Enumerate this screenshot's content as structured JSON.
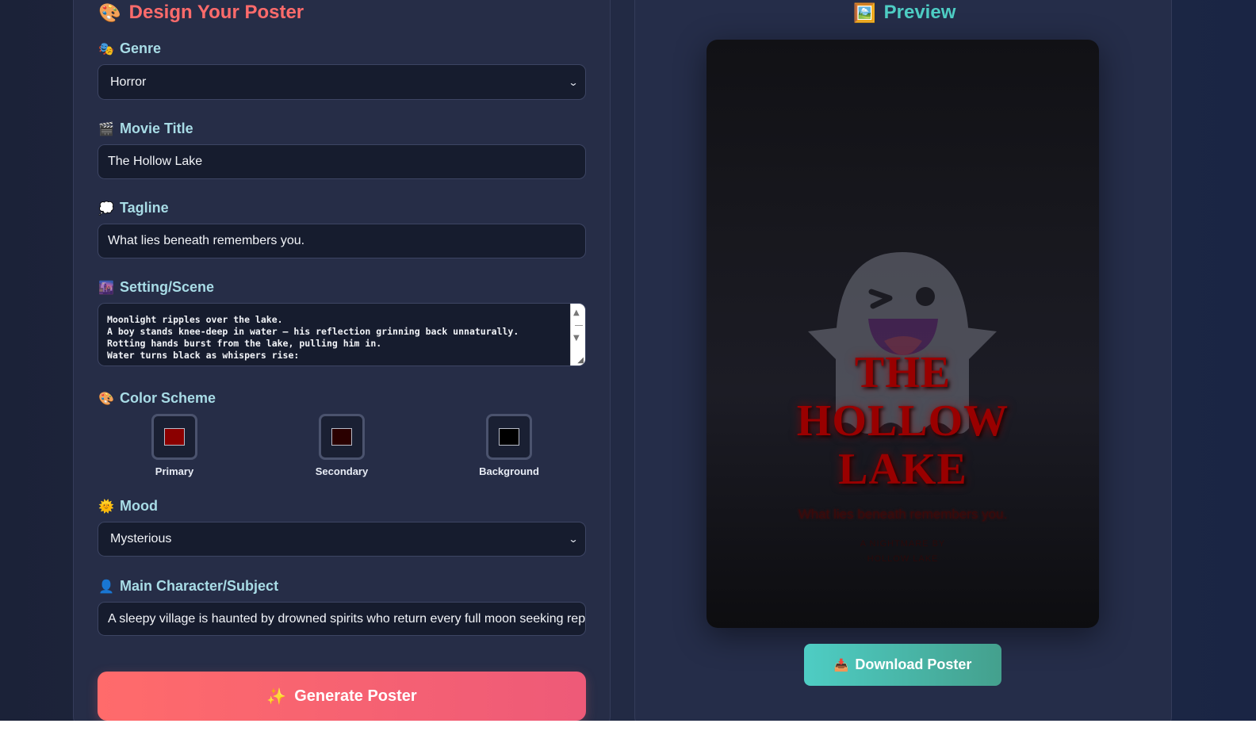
{
  "form": {
    "heading": "Design Your Poster",
    "heading_icon": "palette-icon",
    "genre": {
      "label": "Genre",
      "icon": "theater-masks-icon",
      "value": "Horror"
    },
    "movie_title": {
      "label": "Movie Title",
      "icon": "clapper-board-icon",
      "value": "The Hollow Lake"
    },
    "tagline": {
      "label": "Tagline",
      "icon": "speech-bubble-icon",
      "value": "What lies beneath remembers you."
    },
    "setting": {
      "label": "Setting/Scene",
      "icon": "city-night-icon",
      "value": "Moonlight ripples over the lake.\nA boy stands knee-deep in water — his reflection grinning back unnaturally.\nRotting hands burst from the lake, pulling him in.\nWater turns black as whispers rise:"
    },
    "color_scheme": {
      "label": "Color Scheme",
      "icon": "palette-icon",
      "swatches": [
        {
          "label": "Primary",
          "color": "#8b0000"
        },
        {
          "label": "Secondary",
          "color": "#2a0000"
        },
        {
          "label": "Background",
          "color": "#000000"
        }
      ]
    },
    "mood": {
      "label": "Mood",
      "icon": "sun-icon",
      "value": "Mysterious"
    },
    "main_character": {
      "label": "Main Character/Subject",
      "icon": "person-silhouette-icon",
      "value": "A sleepy village is haunted by drowned spirits who return every full moon seeking rep"
    },
    "generate_button": "Generate Poster",
    "generate_icon": "sparkles-icon"
  },
  "preview": {
    "heading": "Preview",
    "heading_icon": "framed-picture-icon",
    "poster": {
      "title_lines": [
        "THE",
        "HOLLOW",
        "LAKE"
      ],
      "tagline": "What lies beneath remembers you.",
      "credit_lines": [
        "A NIGHTMARE BY",
        "HOLLOW LAKE"
      ],
      "image_icon": "winking-ghost-icon",
      "title_color": "#990000"
    },
    "download_button": "Download Poster",
    "download_icon": "inbox-tray-icon"
  }
}
